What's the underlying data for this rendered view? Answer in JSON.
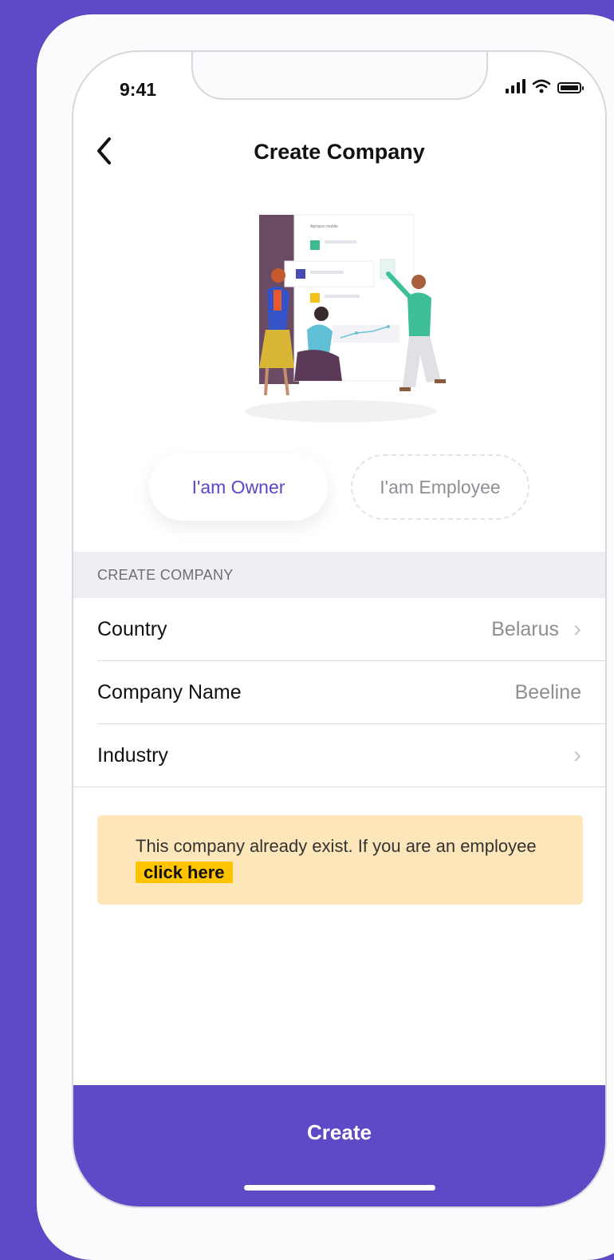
{
  "status_bar": {
    "time": "9:41"
  },
  "nav": {
    "title": "Create Company"
  },
  "segments": {
    "owner": "I'am Owner",
    "employee": "I'am Employee"
  },
  "section": {
    "header": "CREATE COMPANY"
  },
  "form": {
    "rows": [
      {
        "label": "Country",
        "value": "Belarus",
        "has_chevron": true
      },
      {
        "label": "Company Name",
        "value": "Beeline",
        "has_chevron": false
      },
      {
        "label": "Industry",
        "value": "",
        "has_chevron": true
      }
    ]
  },
  "notice": {
    "text": "This company already exist. If you are an employee",
    "link": "click here"
  },
  "footer": {
    "create_label": "Create"
  },
  "illustration": {
    "board_title": "Apropos mobile"
  },
  "colors": {
    "accent": "#5e4ac6",
    "notice_bg": "#fde6b9",
    "notice_link": "#ffc300"
  },
  "icons": [
    "chevron-left-icon",
    "chevron-right-icon",
    "signal-icon",
    "wifi-icon",
    "battery-icon"
  ]
}
